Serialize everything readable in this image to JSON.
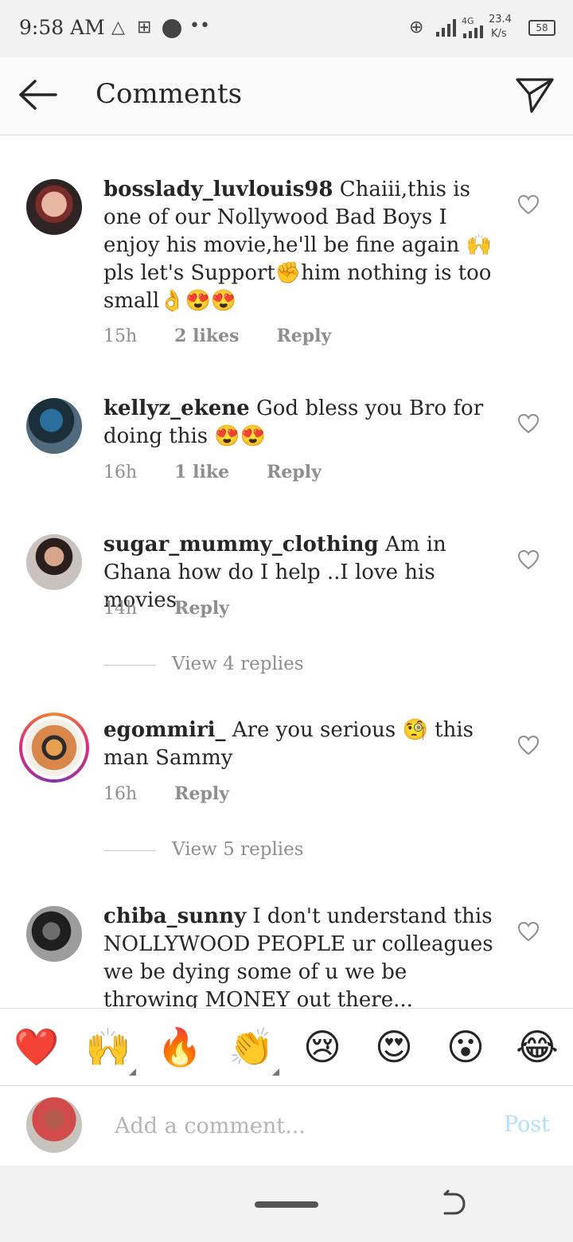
{
  "status_bar": {
    "time": "9:58 AM",
    "net_type": "4G",
    "speed_value": "23.4",
    "speed_unit": "K/s",
    "battery": "58"
  },
  "header": {
    "title": "Comments"
  },
  "comments": [
    {
      "username": "bosslady_luvlouis98",
      "text": " Chaiii,this is one of our Nollywood Bad Boys I enjoy his movie,he'll be fine again 🙌 pls let's Support✊him nothing is too small👌😍😍",
      "time": "15h",
      "likes": "2 likes",
      "reply": "Reply"
    },
    {
      "username": "kellyz_ekene",
      "text": " God bless you Bro for doing this 😍😍",
      "time": "16h",
      "likes": "1 like",
      "reply": "Reply"
    },
    {
      "username": "sugar_mummy_clothing",
      "text": " Am in Ghana how do I help ..I love his movies",
      "time": "14h",
      "reply": "Reply",
      "view_replies": "View 4 replies"
    },
    {
      "username": "egommiri_",
      "text": " Are you serious 🧐 this man Sammy",
      "time": "16h",
      "reply": "Reply",
      "view_replies": "View 5 replies"
    },
    {
      "username": "chiba_sunny",
      "text": " I don't understand this NOLLYWOOD PEOPLE ur colleagues we be dying some of u we be throwing MONEY out there..."
    }
  ],
  "emoji_bar": [
    "❤️",
    "🙌",
    "🔥",
    "👏",
    "😢",
    "😍",
    "😮",
    "😂"
  ],
  "input": {
    "placeholder": "Add a comment...",
    "post_label": "Post"
  },
  "colors": {
    "post_disabled": "#b2dffc",
    "meta_gray": "#8e8e8e",
    "text": "#262626"
  }
}
